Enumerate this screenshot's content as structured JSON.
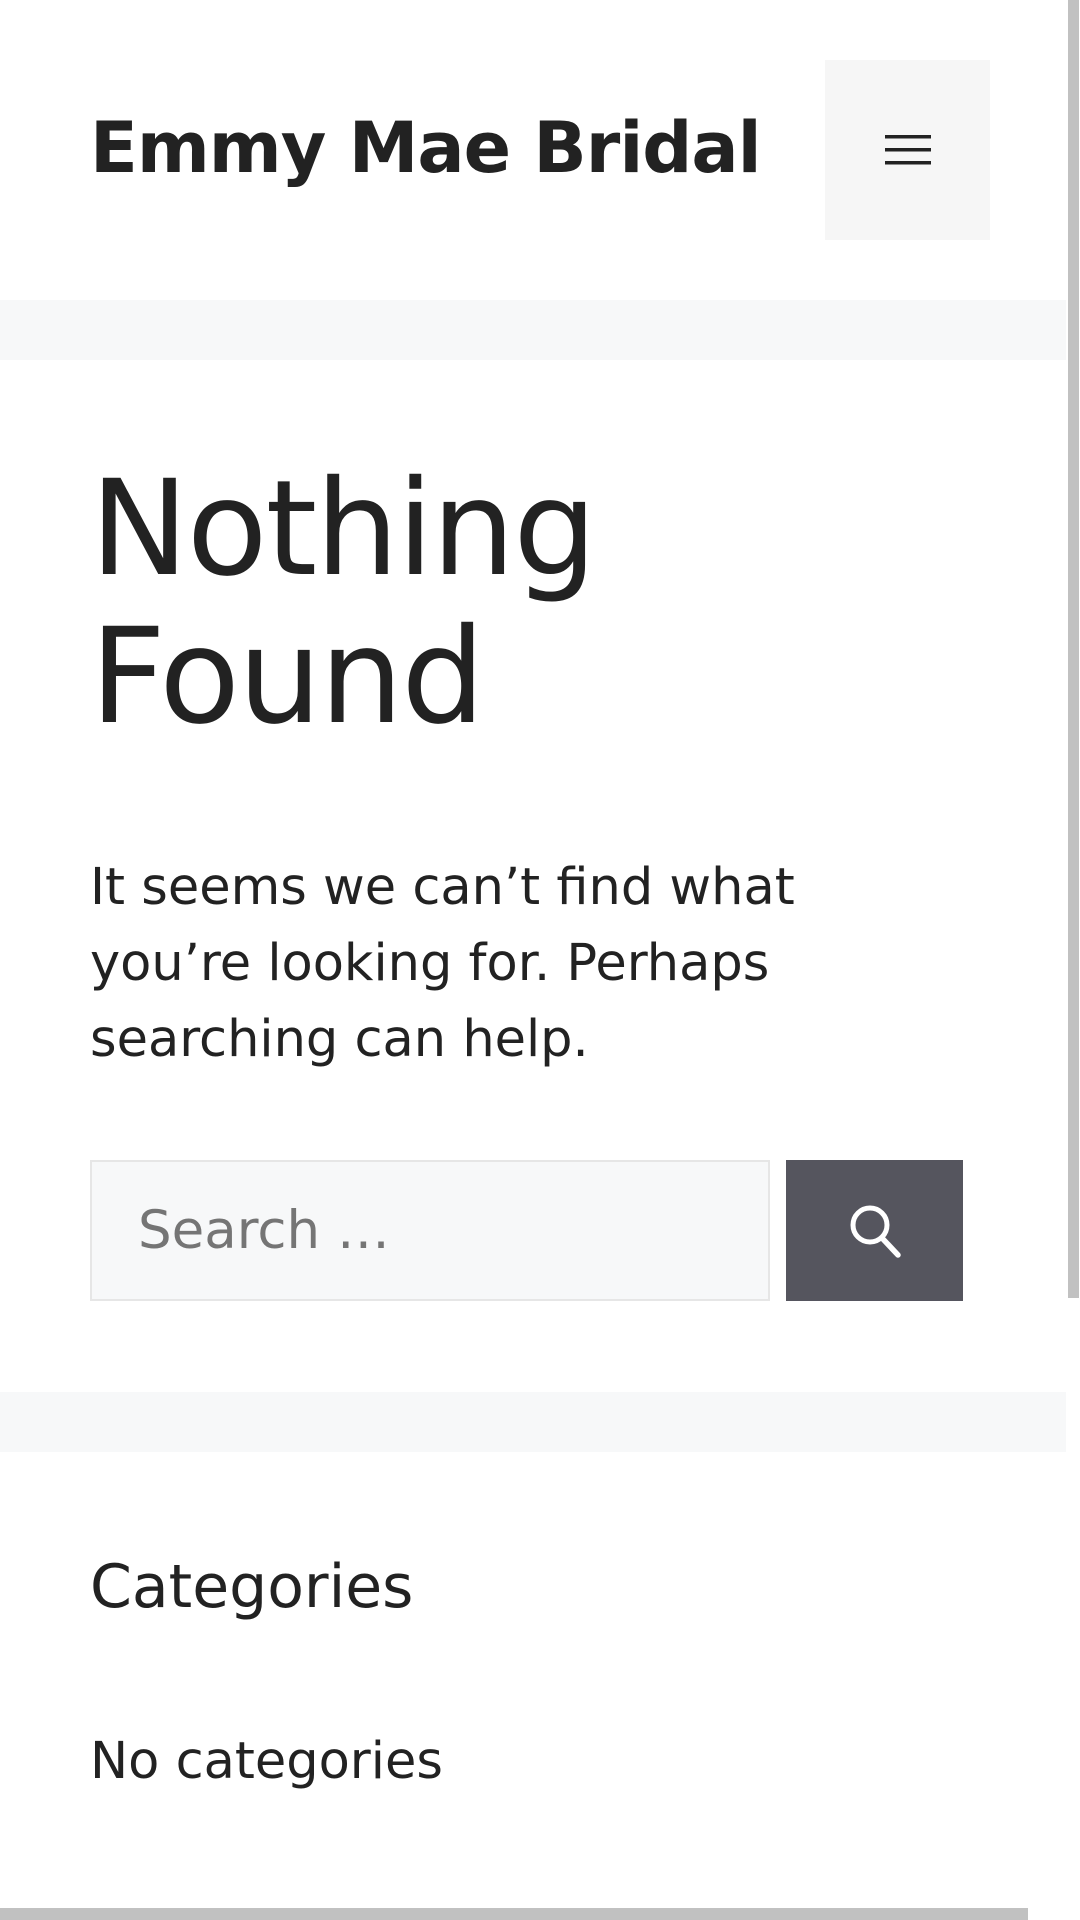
{
  "header": {
    "site_title": "Emmy Mae Bridal",
    "menu_icon": "hamburger-menu-icon"
  },
  "main": {
    "title": "Nothing Found",
    "message": "It seems we can’t find what you’re looking for. Perhaps searching can help.",
    "search": {
      "placeholder": "Search …",
      "value": "",
      "submit_icon": "search-icon"
    }
  },
  "widget": {
    "title": "Categories",
    "empty_text": "No categories"
  },
  "colors": {
    "text": "#222222",
    "separator": "#f7f8f9",
    "search_button": "#55555e",
    "menu_toggle_bg": "#f6f6f6",
    "scrollbar": "#c1c1c1"
  }
}
